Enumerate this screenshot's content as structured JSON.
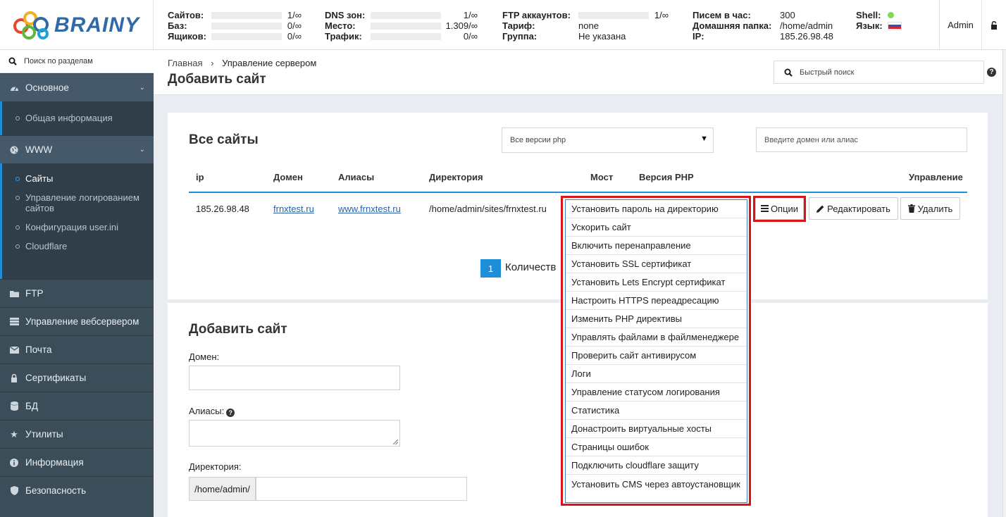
{
  "brand": {
    "name": "BRAINY"
  },
  "stats": {
    "col1": [
      {
        "label": "Сайтов:",
        "value": "1/∞"
      },
      {
        "label": "Баз:",
        "value": "0/∞"
      },
      {
        "label": "Ящиков:",
        "value": "0/∞"
      }
    ],
    "col2": [
      {
        "label": "DNS зон:",
        "value": "1/∞"
      },
      {
        "label": "Место:",
        "value": "1.309/∞"
      },
      {
        "label": "Трафик:",
        "value": "0/∞"
      }
    ],
    "col3": [
      {
        "label": "FTP аккаунтов:",
        "value": "1/∞"
      },
      {
        "label": "Тариф:",
        "value": "none"
      },
      {
        "label": "Группа:",
        "value": "Не указана"
      }
    ],
    "col4": [
      {
        "label": "Писем в час:",
        "value": "300"
      },
      {
        "label": "Домашняя папка:",
        "value": "/home/admin"
      },
      {
        "label": "IP:",
        "value": "185.26.98.48"
      }
    ],
    "col5": [
      {
        "label": "Shell:",
        "status_color": "#7ed957"
      },
      {
        "label": "Язык:",
        "flag": "russia-flag"
      }
    ]
  },
  "user": {
    "name": "Admin"
  },
  "sidebar": {
    "search_placeholder": "Поиск по разделам",
    "sections": [
      {
        "label": "Основное",
        "icon": "dashboard-icon",
        "items": [
          "Общая информация"
        ]
      },
      {
        "label": "WWW",
        "icon": "globe-icon",
        "items": [
          "Сайты",
          "Управление логированием сайтов",
          "Конфигурация user.ini",
          "Cloudflare"
        ]
      },
      {
        "label": "FTP",
        "icon": "folder-icon"
      },
      {
        "label": "Управление вебсервером",
        "icon": "server-icon"
      },
      {
        "label": "Почта",
        "icon": "envelope-icon"
      },
      {
        "label": "Сертификаты",
        "icon": "lock-icon"
      },
      {
        "label": "БД",
        "icon": "database-icon"
      },
      {
        "label": "Утилиты",
        "icon": "star-icon"
      },
      {
        "label": "Информация",
        "icon": "info-icon"
      },
      {
        "label": "Безопасность",
        "icon": "shield-icon"
      }
    ]
  },
  "header": {
    "breadcrumb": [
      "Главная",
      "Управление сервером"
    ],
    "title": "Добавить сайт",
    "quick_search_placeholder": "Быстрый поиск"
  },
  "sites": {
    "title": "Все сайты",
    "php_filter": "Все версии php",
    "domain_search_placeholder": "Введите домен или алиас",
    "columns": [
      "ip",
      "Домен",
      "Алиасы",
      "Директория",
      "Мост",
      "Версия PHP",
      "Управление"
    ],
    "rows": [
      {
        "ip": "185.26.98.48",
        "domain": "frnxtest.ru",
        "alias": "www.frnxtest.ru",
        "directory": "/home/admin/sites/frnxtest.ru"
      }
    ],
    "actions": {
      "options": "Опции",
      "edit": "Редактировать",
      "delete": "Удалить"
    },
    "pagination": {
      "page": "1",
      "count_label": "Количеств"
    }
  },
  "add_site": {
    "title": "Добавить сайт",
    "domain_label": "Домен:",
    "aliases_label": "Алиасы:",
    "directory_label": "Директория:",
    "directory_prefix": "/home/admin/"
  },
  "options_menu": [
    "Установить пароль на директорию",
    "Ускорить сайт",
    "Включить перенаправление",
    "Установить SSL сертификат",
    "Установить Lets Encrypt сертификат",
    "Настроить HTTPS переадресацию",
    "Изменить PHP директивы",
    "Управлять файлами в файлменеджере",
    "Проверить сайт антивирусом",
    "Логи",
    "Управление статусом логирования",
    "Статистика",
    "Донастроить виртуальные хосты",
    "Страницы ошибок",
    "Подключить cloudflare защиту",
    "Установить CMS через автоустановщик"
  ]
}
